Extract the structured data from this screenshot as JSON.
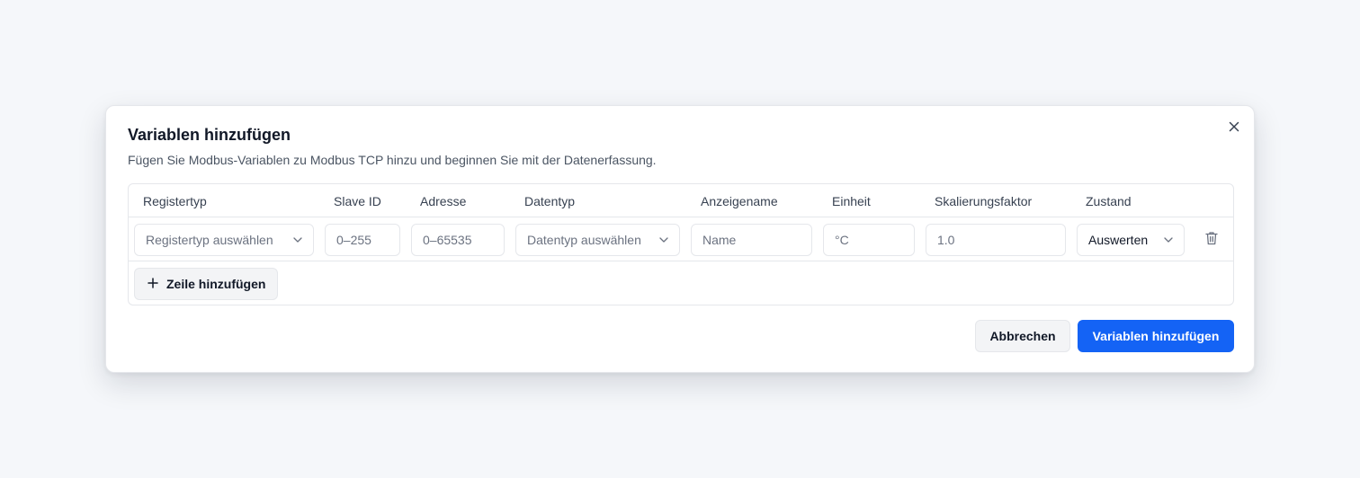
{
  "dialog": {
    "title": "Variablen hinzufügen",
    "description": "Fügen Sie Modbus-Variablen zu Modbus TCP hinzu und beginnen Sie mit der Datenerfassung."
  },
  "table": {
    "headers": {
      "register_type": "Registertyp",
      "slave_id": "Slave ID",
      "address": "Adresse",
      "data_type": "Datentyp",
      "display_name": "Anzeigename",
      "unit": "Einheit",
      "scale_factor": "Skalierungsfaktor",
      "state": "Zustand"
    },
    "row": {
      "register_type_placeholder": "Registertyp auswählen",
      "slave_id_placeholder": "0–255",
      "address_placeholder": "0–65535",
      "data_type_placeholder": "Datentyp auswählen",
      "display_name_placeholder": "Name",
      "unit_placeholder": "°C",
      "scale_factor_placeholder": "1.0",
      "state_value": "Auswerten"
    },
    "add_row_label": "Zeile hinzufügen"
  },
  "footer": {
    "cancel_label": "Abbrechen",
    "submit_label": "Variablen hinzufügen"
  },
  "icons": {
    "close": "close-icon",
    "chevron": "chevron-down-icon",
    "trash": "trash-icon",
    "plus": "plus-icon"
  },
  "colors": {
    "accent": "#1463f5",
    "page_background": "#f5f7fa",
    "border": "#e5e7eb"
  }
}
